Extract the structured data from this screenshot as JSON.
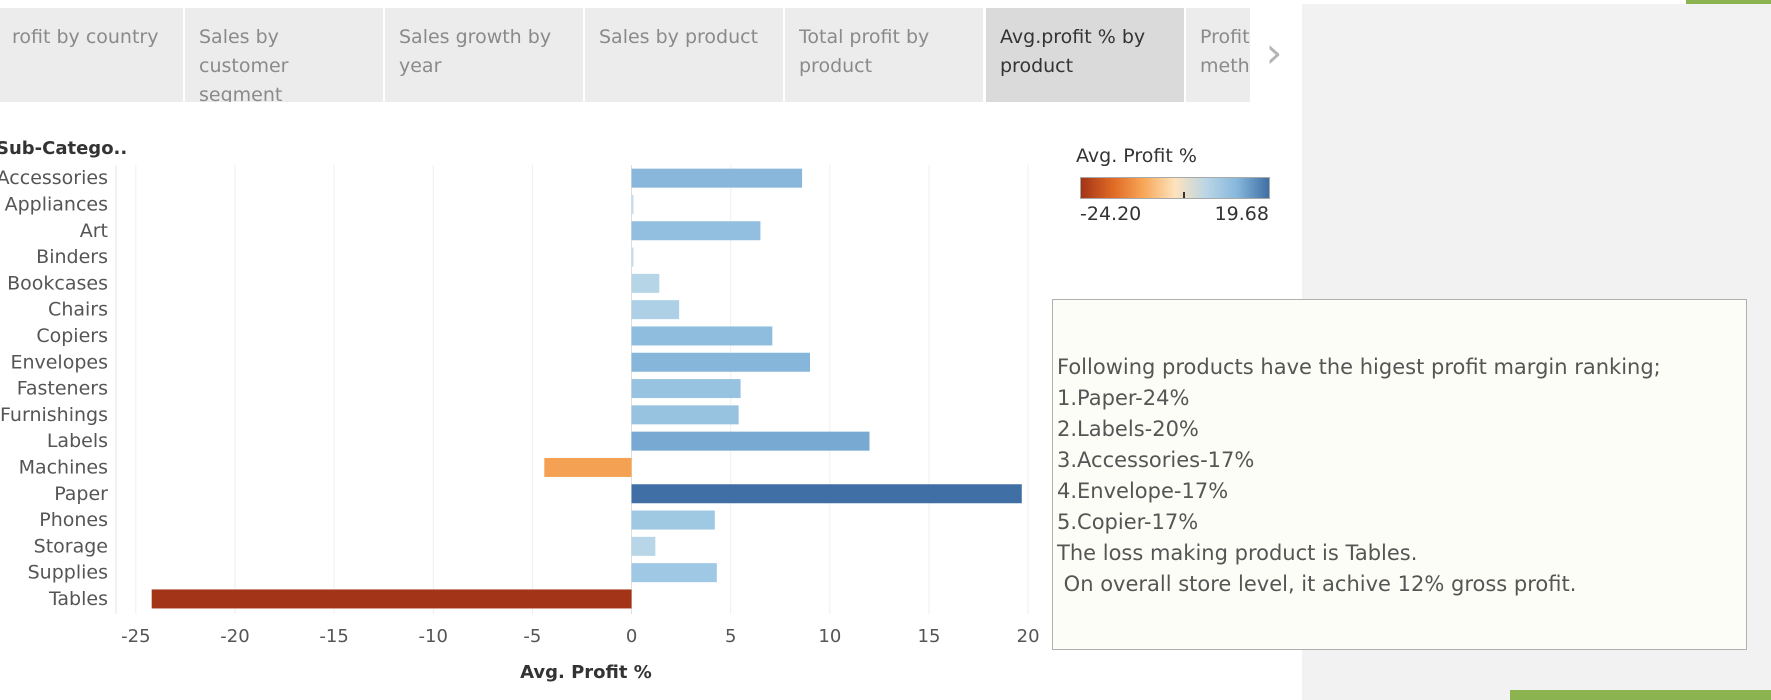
{
  "tabs": [
    {
      "label": "rofit by country",
      "active": false
    },
    {
      "label": "Sales by customer segment",
      "active": false
    },
    {
      "label": "Sales growth by year",
      "active": false
    },
    {
      "label": "Sales by product",
      "active": false
    },
    {
      "label": "Total profit by product",
      "active": false
    },
    {
      "label": "Avg.profit % by product",
      "active": true
    },
    {
      "label": "Profit meth",
      "active": false
    }
  ],
  "tab_next_icon": "chevron-right-icon",
  "legend": {
    "title": "Avg. Profit %",
    "min_label": "-24.20",
    "max_label": "19.68",
    "colors": [
      "#a33418",
      "#df6a24",
      "#f7a657",
      "#fde3bd",
      "#b9d5e6",
      "#86b7db",
      "#3f6fa4"
    ]
  },
  "annotation": {
    "lines": [
      "Following products have the higest profit margin ranking;",
      "1.Paper-24%",
      "2.Labels-20%",
      "3.Accessories-17%",
      "4.Envelope-17%",
      "5.Copier-17%",
      "The loss making product is Tables.",
      " On overall store level, it achive 12% gross profit."
    ]
  },
  "chart_data": {
    "type": "bar",
    "orientation": "horizontal",
    "row_header": "Sub-Catego..",
    "xlabel": "Avg. Profit %",
    "categories": [
      "Accessories",
      "Appliances",
      "Art",
      "Binders",
      "Bookcases",
      "Chairs",
      "Copiers",
      "Envelopes",
      "Fasteners",
      "Furnishings",
      "Labels",
      "Machines",
      "Paper",
      "Phones",
      "Storage",
      "Supplies",
      "Tables"
    ],
    "values": [
      8.6,
      0.1,
      6.5,
      0.1,
      1.4,
      2.4,
      7.1,
      9.0,
      5.5,
      5.4,
      12.0,
      -4.4,
      19.68,
      4.2,
      1.2,
      4.3,
      -24.2
    ],
    "xlim": [
      -26,
      20.7
    ],
    "xticks": [
      -25,
      -20,
      -15,
      -10,
      -5,
      0,
      5,
      10,
      15,
      20
    ],
    "grid": true
  }
}
